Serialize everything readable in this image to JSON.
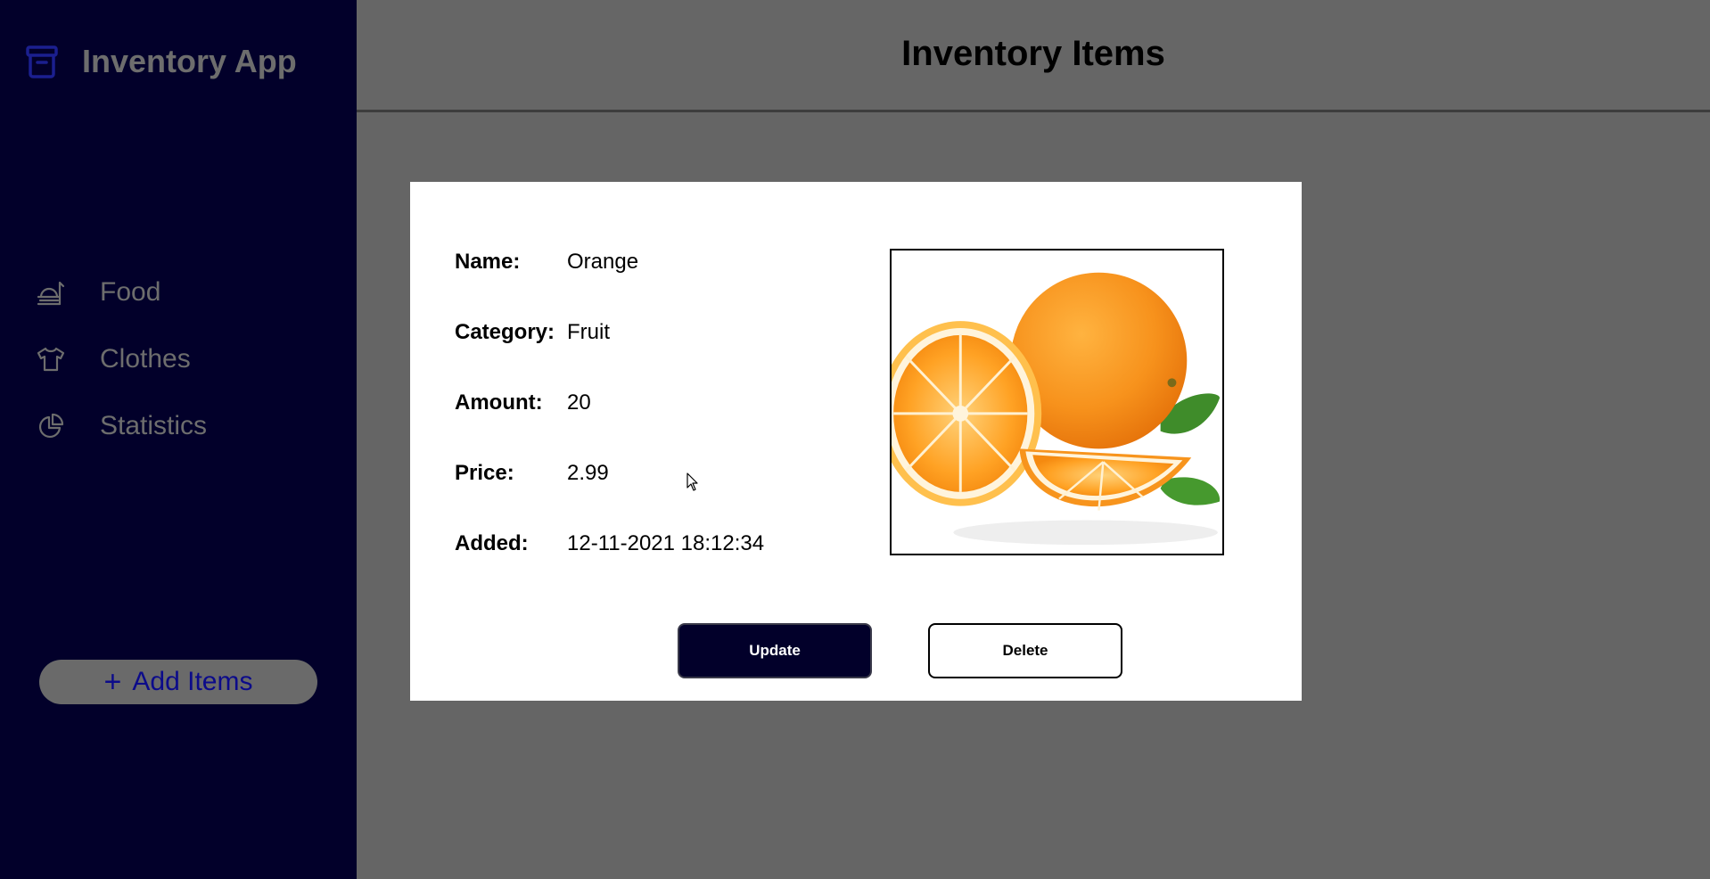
{
  "app": {
    "title": "Inventory App",
    "logo_icon": "archive-box-icon",
    "accent_color": "#1b1f8f",
    "sidebar_bg": "#02002a"
  },
  "sidebar": {
    "items": [
      {
        "label": "Food",
        "icon": "food-tray-icon"
      },
      {
        "label": "Clothes",
        "icon": "shirt-icon"
      },
      {
        "label": "Statistics",
        "icon": "pie-chart-icon"
      }
    ],
    "add_button": {
      "label": "Add Items",
      "icon": "plus-icon"
    }
  },
  "header": {
    "title": "Inventory Items"
  },
  "item": {
    "fields": [
      {
        "label": "Name:",
        "value": "Orange"
      },
      {
        "label": "Category:",
        "value": "Fruit"
      },
      {
        "label": "Amount:",
        "value": "20"
      },
      {
        "label": "Price:",
        "value": "2.99"
      },
      {
        "label": "Added:",
        "value": "12-11-2021 18:12:34"
      }
    ],
    "image_icon": "orange-fruit-image"
  },
  "actions": {
    "update_label": "Update",
    "delete_label": "Delete"
  }
}
